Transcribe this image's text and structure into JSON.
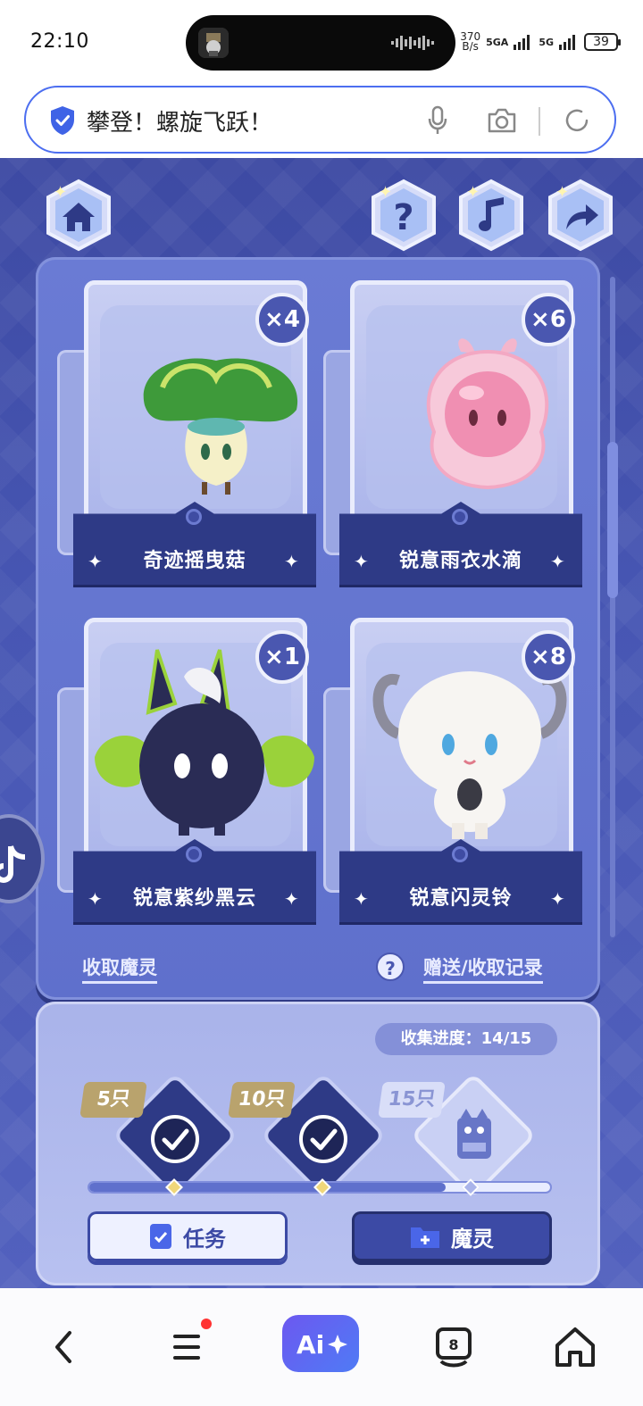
{
  "status_bar": {
    "time": "22:10",
    "net_speed_value": "370",
    "net_speed_unit": "B/s",
    "signal_1": "5GA",
    "signal_2": "5G",
    "battery": "39"
  },
  "search": {
    "query": "攀登！螺旋飞跃！"
  },
  "game": {
    "cards": [
      {
        "name": "奇迹摇曳菇",
        "count": "×4"
      },
      {
        "name": "锐意雨衣水滴",
        "count": "×6"
      },
      {
        "name": "锐意紫纱黑云",
        "count": "×1"
      },
      {
        "name": "锐意闪灵铃",
        "count": "×8"
      }
    ],
    "collect_link": "收取魔灵",
    "history_link": "赠送/收取记录",
    "help_mark": "?",
    "progress_label": "收集进度：14/15",
    "progress": {
      "collected": 14,
      "total": 15
    },
    "milestones": [
      {
        "label": "5只",
        "done": true
      },
      {
        "label": "10只",
        "done": true
      },
      {
        "label": "15只",
        "done": false
      }
    ],
    "task_button": "任务",
    "spirit_button": "魔灵"
  },
  "colors": {
    "accent": "#4c6ef0",
    "panel": "#5f70cc",
    "dark_label": "#2e3a86"
  }
}
